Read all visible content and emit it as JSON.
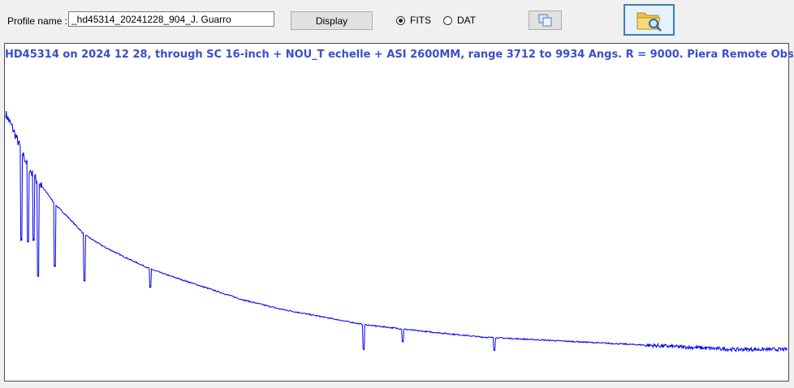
{
  "profile": {
    "label": "Profile name :",
    "value": "_hd45314_20241228_904_J. Guarro"
  },
  "toolbar": {
    "display_label": "Display",
    "fits_label": "FITS",
    "dat_label": "DAT",
    "selected_format": "FITS",
    "copy_icon": "copy-icon",
    "open_icon": "folder-search-icon"
  },
  "plot": {
    "title": "HD45314 on 2024 12 28, through SC 16-inch + NOU_T echelle + ASI 2600MM, range 3712 to 9934 Angs.  R = 9000.  Piera Remote Obs.",
    "line_color": "#0000ee",
    "title_color": "#3b4ec9"
  },
  "chart_data": {
    "type": "line",
    "title": "HD45314 on 2024 12 28, through SC 16-inch + NOU_T echelle + ASI 2600MM, range 3712 to 9934 Angs.  R = 9000.  Piera Remote Obs.",
    "xlabel": "",
    "ylabel": "",
    "x_unit": "Angs.",
    "xlim": [
      3712,
      9934
    ],
    "grid": false,
    "series": [
      {
        "x": [
          3712,
          3760,
          3800,
          3850,
          3900,
          3970,
          4050,
          4100,
          4200,
          4340,
          4500,
          4700,
          4861,
          5000,
          5300,
          5600,
          5900,
          6300,
          6563,
          7000,
          7500,
          8000,
          8500,
          9000,
          9500,
          9934
        ],
        "y": [
          0.84,
          0.8,
          0.76,
          0.71,
          0.66,
          0.62,
          0.58,
          0.55,
          0.51,
          0.45,
          0.41,
          0.37,
          0.34,
          0.32,
          0.28,
          0.24,
          0.21,
          0.18,
          0.16,
          0.14,
          0.12,
          0.11,
          0.1,
          0.09,
          0.08,
          0.08
        ]
      }
    ],
    "absorption_lines": [
      {
        "x": 3835,
        "depth": 0.3
      },
      {
        "x": 3889,
        "depth": 0.25
      },
      {
        "x": 3933,
        "depth": 0.2
      },
      {
        "x": 3970,
        "depth": 0.3
      },
      {
        "x": 4101,
        "depth": 0.2
      },
      {
        "x": 4340,
        "depth": 0.15
      },
      {
        "x": 4861,
        "depth": 0.06
      },
      {
        "x": 6563,
        "depth": 0.08
      },
      {
        "x": 6870,
        "depth": 0.04
      },
      {
        "x": 7600,
        "depth": 0.04
      }
    ]
  }
}
